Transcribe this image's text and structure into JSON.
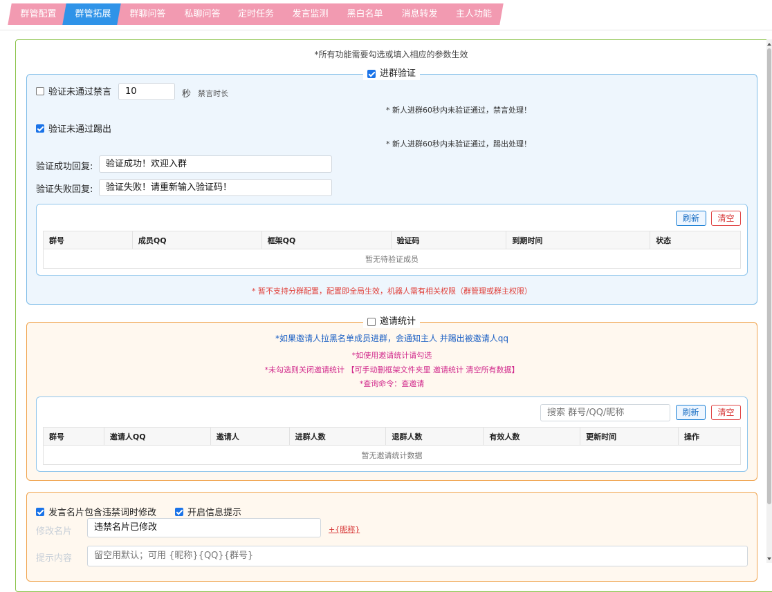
{
  "tabs": [
    "群管配置",
    "群管拓展",
    "群聊问答",
    "私聊问答",
    "定时任务",
    "发言监测",
    "黑白名单",
    "消息转发",
    "主人功能"
  ],
  "active_tab": "群管拓展",
  "top_note": "*所有功能需要勾选或填入相应的参数生效",
  "verify": {
    "legend": "进群验证",
    "legend_checked": true,
    "mute": {
      "label": "验证未通过禁言",
      "checked": false,
      "value": "10",
      "unit": "秒",
      "unit_hint": "禁言时长"
    },
    "mute_hint": "* 新人进群60秒内未验证通过，禁言处理！",
    "kick": {
      "label": "验证未通过踢出",
      "checked": true
    },
    "kick_hint": "* 新人进群60秒内未验证通过，踢出处理！",
    "success_label": "验证成功回复:",
    "success_value": "验证成功！欢迎入群",
    "fail_label": "验证失败回复:",
    "fail_value": "验证失败！请重新输入验证码！",
    "refresh": "刷新",
    "clear": "清空",
    "columns": [
      "群号",
      "成员QQ",
      "框架QQ",
      "验证码",
      "到期时间",
      "状态"
    ],
    "empty": "暂无待验证成员",
    "footer_note": "* 暂不支持分群配置，配置即全局生效，机器人需有相关权限（群管理或群主权限）"
  },
  "invite": {
    "legend": "邀请统计",
    "legend_checked": false,
    "note1": "*如果邀请人拉黑名单成员进群，会通知主人 并踢出被邀请人qq",
    "note2": "*如使用邀请统计请勾选",
    "note3": "*未勾选则关闭邀请统计 【可手动删框架文件夹里 邀请统计 清空所有数据】",
    "note4": "*查询命令：查邀请",
    "search_placeholder": "搜索 群号/QQ/昵称",
    "refresh": "刷新",
    "clear": "清空",
    "columns": [
      "群号",
      "邀请人QQ",
      "邀请人",
      "进群人数",
      "退群人数",
      "有效人数",
      "更新时间",
      "操作"
    ],
    "empty": "暂无邀请统计数据"
  },
  "card": {
    "opt1": {
      "label": "发言名片包含违禁词时修改",
      "checked": true
    },
    "opt2": {
      "label": "开启信息提示",
      "checked": true
    },
    "label1": "修改名片",
    "value1": "违禁名片已修改",
    "var_link": "+{昵称}",
    "label2": "提示内容",
    "placeholder2": "留空用默认；可用 {昵称}{QQ}{群号}"
  }
}
